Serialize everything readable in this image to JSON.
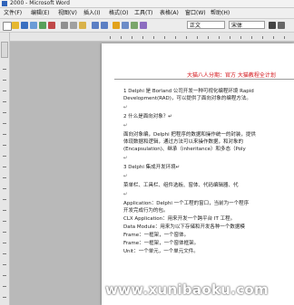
{
  "window": {
    "title": "2000 - Microsoft Word"
  },
  "menu": [
    "文件(F)",
    "编辑(E)",
    "视图(V)",
    "插入(I)",
    "格式(O)",
    "工具(T)",
    "表格(A)",
    "窗口(W)",
    "帮助(H)"
  ],
  "toolbar": {
    "style_value": "正文",
    "font_value": "宋体"
  },
  "document": {
    "header_text": "大猫八人分期：官方 大猫教程全计划",
    "paragraphs": [
      "1  Delphi 是 Borland 公司开发一种可视化编程环境 Rapid",
      "Development(RAD)，可以提供了面向对象的编程方法。",
      "↵",
      "2  什么是面向对象？↵",
      "↵",
      "面向对象编，Delphi 把程序的数据和操作统一的封装，提供",
      "体现数据和逻辑，通过方法可以来操作数据，和对象的",
      "(Encapsulation)、继承（inheritance）和多态（Poly",
      "↵",
      "3  Delphi 集成开发环境↵",
      "↵",
      "菜单栏、工具栏、组件选板、窗体、代码编辑器、代",
      "↵",
      "Application：Delphi 一个工程的窗口，当前为一个程序",
      "开发完成行为的包。",
      "CLX Application：用来开发一个跨平台 IT 工程。",
      "Data Module：用来为以下存储和开发各种一个数据模",
      "Frame：一框架，一个窗体。",
      "Frame：一框架，一个窗体框架。",
      "Unit：一个单元，一个单元文件。"
    ]
  },
  "watermark": "www.xunibaoku.com",
  "colors": {
    "header": "#d4141a",
    "workspace": "#b9b9b9",
    "page": "#ffffff"
  }
}
